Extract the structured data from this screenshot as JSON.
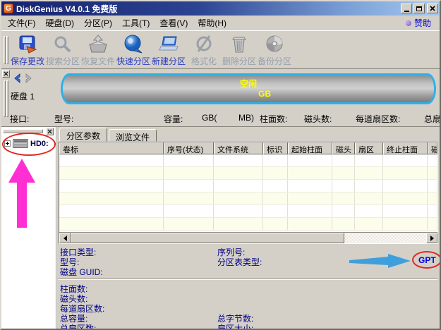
{
  "window": {
    "title": "DiskGenius V4.0.1 免费版",
    "icon_letter": "G"
  },
  "menu": {
    "items": [
      "文件(F)",
      "硬盘(D)",
      "分区(P)",
      "工具(T)",
      "查看(V)",
      "帮助(H)"
    ],
    "sponsor_label": "赞助"
  },
  "toolbar": {
    "buttons": [
      {
        "label": "保存更改",
        "icon": "save-changes-icon",
        "enabled": true
      },
      {
        "label": "搜索分区",
        "icon": "search-partition-icon",
        "enabled": false
      },
      {
        "label": "恢复文件",
        "icon": "recover-files-icon",
        "enabled": false
      },
      {
        "label": "快速分区",
        "icon": "quick-partition-icon",
        "enabled": true
      },
      {
        "label": "新建分区",
        "icon": "new-partition-icon",
        "enabled": true
      },
      {
        "label": "格式化",
        "icon": "format-icon",
        "enabled": false
      },
      {
        "label": "删除分区",
        "icon": "delete-partition-icon",
        "enabled": false
      },
      {
        "label": "备份分区",
        "icon": "backup-partition-icon",
        "enabled": false
      }
    ]
  },
  "disk_overview": {
    "disk_label": "硬盘 1",
    "free_space_label": "空闲",
    "free_space_size": "GB",
    "info_labels": {
      "interface": "接口:",
      "model": "型号:",
      "capacity": "容量:",
      "capacity_gb": "GB(",
      "capacity_mb": "MB)",
      "cylinders": "柱面数:",
      "heads": "磁头数:",
      "sectors_per_track": "每道扇区数:",
      "total_sectors": "总扇区数:"
    }
  },
  "sidebar": {
    "tree_item_label": "HD0:"
  },
  "tabs": {
    "partition_params": "分区参数",
    "browse_files": "浏览文件"
  },
  "table": {
    "headers": [
      "卷标",
      "序号(状态)",
      "文件系统",
      "标识",
      "起始柱面",
      "磁头",
      "扇区",
      "终止柱面",
      "磁头"
    ],
    "empty_row_count": 6
  },
  "details": {
    "interface_type": "接口类型:",
    "model": "型号:",
    "disk_guid": "磁盘 GUID:",
    "serial_number": "序列号:",
    "partition_table_type": "分区表类型:",
    "partition_table_value": "GPT",
    "cylinders": "柱面数:",
    "heads": "磁头数:",
    "sectors_per_track": "每道扇区数:",
    "total_capacity": "总容量:",
    "total_bytes": "总字节数:",
    "total_sectors": "总扇区数:",
    "sector_size": "扇区大小:"
  },
  "colors": {
    "accent_cyan": "#2fb0e8",
    "free_text_yellow": "#ffff00",
    "annotation_pink": "#ff2fd4",
    "annotation_blue": "#3f9fdd",
    "annotation_red": "#e02820",
    "sponsor_text": "#0000cc",
    "label_navy": "#000080",
    "gpt_blue": "#0000e0"
  }
}
